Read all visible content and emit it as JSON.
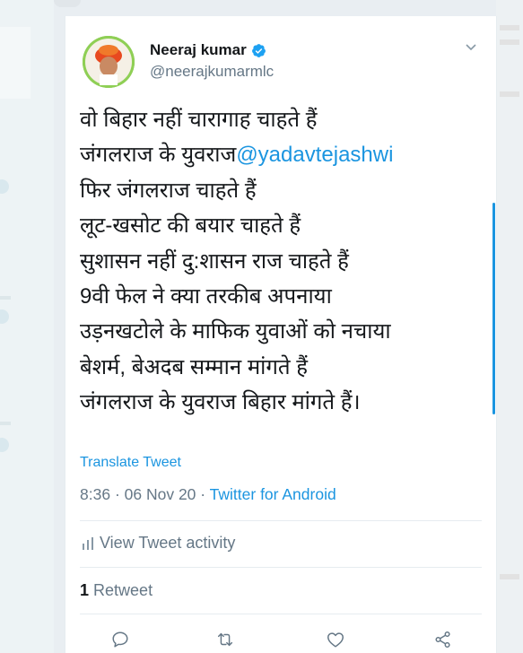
{
  "tweet": {
    "author_name": "Neeraj kumar",
    "handle": "@neerajkumarmlc",
    "lines": [
      {
        "text": "वो बिहार नहीं चारागाह चाहते हैं"
      },
      {
        "text": "जंगलराज के युवराज",
        "mention": "@yadavtejashwi"
      },
      {
        "text": "फिर जंगलराज चाहते हैं"
      },
      {
        "text": "लूट-खसोट की बयार चाहते हैं"
      },
      {
        "text": "सुशासन नहीं दु:शासन राज चाहते हैं"
      },
      {
        "text": "9वी फेल ने क्या तरकीब अपनाया"
      },
      {
        "text": "उड़नखटोले के माफिक युवाओं को नचाया"
      },
      {
        "text": "बेशर्म, बेअदब सम्मान मांगते हैं"
      },
      {
        "text": "जंगलराज के युवराज बिहार मांगते हैं।"
      }
    ],
    "translate_label": "Translate Tweet",
    "time": "8:36",
    "date": "06 Nov 20",
    "separator": "·",
    "source": "Twitter for Android",
    "activity_label": "View Tweet activity",
    "retweet_count": "1",
    "retweet_label": "Retweet"
  },
  "icons": {
    "verified": "verified-badge-icon",
    "more": "chevron-down-icon",
    "activity": "bar-chart-icon",
    "reply": "reply-icon",
    "retweet": "retweet-icon",
    "like": "heart-icon",
    "share": "share-icon"
  },
  "colors": {
    "link": "#1b95e0",
    "muted": "#657786",
    "text": "#14171a",
    "background": "#e9eef2"
  }
}
